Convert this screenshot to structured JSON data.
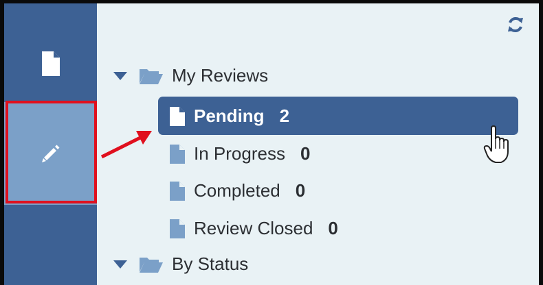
{
  "icons": {
    "docs": "document-icon",
    "review": "pencil-icon",
    "refresh": "refresh-icon",
    "expand": "caret-down-icon",
    "folder": "open-folder-icon",
    "file": "file-icon"
  },
  "colors": {
    "rail": "#3d6194",
    "rail_active": "#7ba0c8",
    "panel_bg": "#e9f2f5",
    "highlight": "#e0101e",
    "file_icon": "#7ba0c8"
  },
  "tree": {
    "my_reviews": {
      "label": "My Reviews",
      "items": [
        {
          "label": "Pending",
          "count": "2"
        },
        {
          "label": "In Progress",
          "count": "0"
        },
        {
          "label": "Completed",
          "count": "0"
        },
        {
          "label": "Review Closed",
          "count": "0"
        }
      ]
    },
    "by_status": {
      "label": "By Status"
    }
  }
}
